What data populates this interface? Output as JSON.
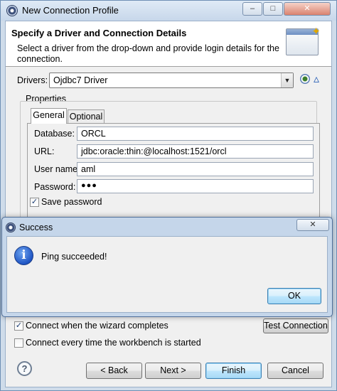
{
  "main_window": {
    "title": "New Connection Profile",
    "controls": {
      "minimize": "–",
      "maximize": "□",
      "close": "✕"
    }
  },
  "header": {
    "title": "Specify a Driver and Connection Details",
    "description": "Select a driver from the drop-down and provide login details for the connection."
  },
  "drivers": {
    "label": "Drivers:",
    "selected": "Ojdbc7 Driver"
  },
  "properties": {
    "label": "Properties",
    "tabs": [
      {
        "label": "General"
      },
      {
        "label": "Optional"
      }
    ],
    "fields": {
      "database": {
        "label": "Database:",
        "value": "ORCL"
      },
      "url": {
        "label": "URL:",
        "value": "jdbc:oracle:thin:@localhost:1521/orcl"
      },
      "username": {
        "label": "User name:",
        "value": "aml"
      },
      "password": {
        "label": "Password:",
        "value": "●●●"
      }
    },
    "save_password": {
      "label": "Save password",
      "checked": true
    }
  },
  "options": {
    "connect_on_finish": {
      "label": "Connect when the wizard completes",
      "checked": true
    },
    "connect_on_startup": {
      "label": "Connect every time the workbench is started",
      "checked": false
    },
    "test_connection_label": "Test Connection"
  },
  "footer": {
    "help_glyph": "?",
    "back_label": "< Back",
    "next_label": "Next >",
    "finish_label": "Finish",
    "cancel_label": "Cancel"
  },
  "success_dialog": {
    "title": "Success",
    "close_glyph": "✕",
    "info_glyph": "i",
    "message": "Ping succeeded!",
    "ok_label": "OK"
  },
  "icons": {
    "app": "eclipse-icon",
    "banner": "wizard-window-icon",
    "new_driver": "new-driver-icon",
    "edit_driver": "edit-driver-icon",
    "help": "help-icon",
    "info": "info-icon"
  }
}
